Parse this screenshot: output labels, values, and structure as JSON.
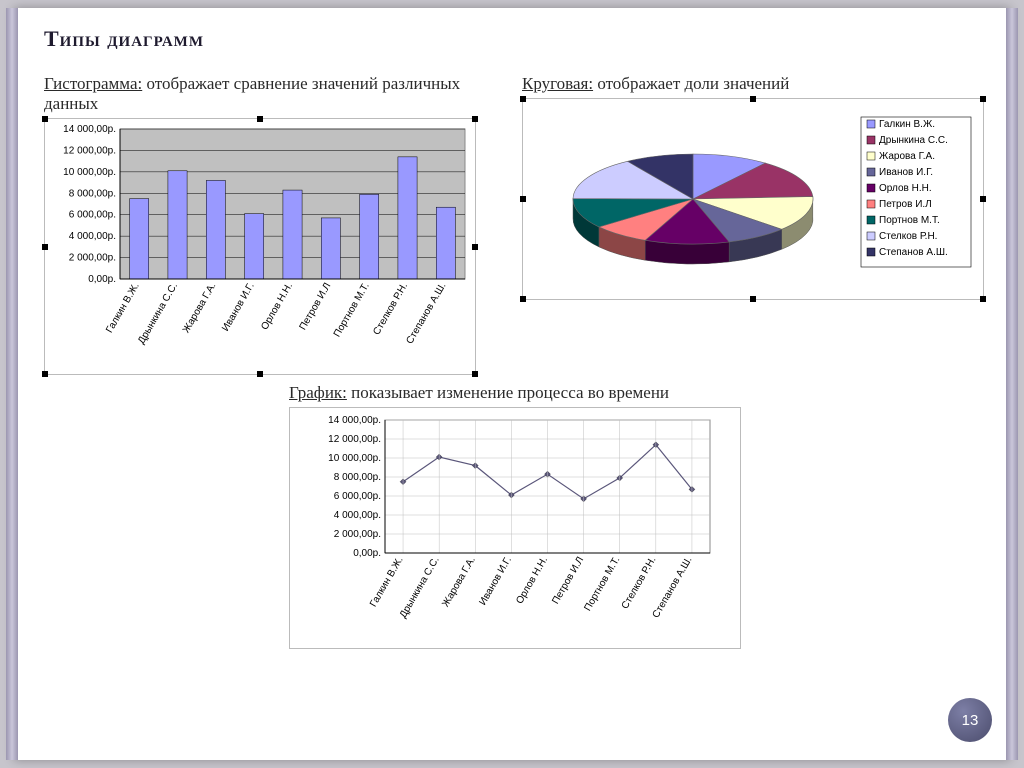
{
  "slide": {
    "title": "Типы диаграмм",
    "page_number": "13"
  },
  "captions": {
    "bar_lead": "Гистограмма:",
    "bar_rest": " отображает сравнение значений различных данных",
    "pie_lead": "Круговая:",
    "pie_rest": " отображает  доли значений",
    "line_lead": "График:",
    "line_rest": "  показывает изменение процесса во времени"
  },
  "chart_data": [
    {
      "id": "bar",
      "type": "bar",
      "categories": [
        "Галкин В.Ж.",
        "Дрынкина С.С.",
        "Жарова Г.А.",
        "Иванов И.Г.",
        "Орлов Н.Н.",
        "Петров И.Л",
        "Портнов М.Т.",
        "Стелков Р.Н.",
        "Степанов А.Ш."
      ],
      "values": [
        7500,
        10100,
        9200,
        6100,
        8300,
        5700,
        7900,
        11400,
        6700
      ],
      "ylim": [
        0,
        14000
      ],
      "y_ticks": [
        "0,00р.",
        "2 000,00р.",
        "4 000,00р.",
        "6 000,00р.",
        "8 000,00р.",
        "10 000,00р.",
        "12 000,00р.",
        "14 000,00р."
      ],
      "y_tick_vals": [
        0,
        2000,
        4000,
        6000,
        8000,
        10000,
        12000,
        14000
      ]
    },
    {
      "id": "pie",
      "type": "pie",
      "series": [
        {
          "name": "Галкин В.Ж.",
          "value": 7500,
          "color": "#9999ff"
        },
        {
          "name": "Дрынкина С.С.",
          "value": 10100,
          "color": "#993366"
        },
        {
          "name": "Жарова Г.А.",
          "value": 9200,
          "color": "#ffffcc"
        },
        {
          "name": "Иванов И.Г.",
          "value": 6100,
          "color": "#666699"
        },
        {
          "name": "Орлов Н.Н.",
          "value": 8300,
          "color": "#660066"
        },
        {
          "name": "Петров И.Л",
          "value": 5700,
          "color": "#ff8080"
        },
        {
          "name": "Портнов М.Т.",
          "value": 7900,
          "color": "#006666"
        },
        {
          "name": "Стелков Р.Н.",
          "value": 11400,
          "color": "#ccccff"
        },
        {
          "name": "Степанов А.Ш.",
          "value": 6700,
          "color": "#333366"
        }
      ]
    },
    {
      "id": "line",
      "type": "line",
      "categories": [
        "Галкин В.Ж.",
        "Дрынкина С.С.",
        "Жарова Г.А.",
        "Иванов И.Г.",
        "Орлов Н.Н.",
        "Петров И.Л",
        "Портнов М.Т.",
        "Стелков Р.Н.",
        "Степанов А.Ш."
      ],
      "values": [
        7500,
        10100,
        9200,
        6100,
        8300,
        5700,
        7900,
        11400,
        6700
      ],
      "ylim": [
        0,
        14000
      ],
      "y_ticks": [
        "0,00р.",
        "2 000,00р.",
        "4 000,00р.",
        "6 000,00р.",
        "8 000,00р.",
        "10 000,00р.",
        "12 000,00р.",
        "14 000,00р."
      ],
      "y_tick_vals": [
        0,
        2000,
        4000,
        6000,
        8000,
        10000,
        12000,
        14000
      ]
    }
  ]
}
